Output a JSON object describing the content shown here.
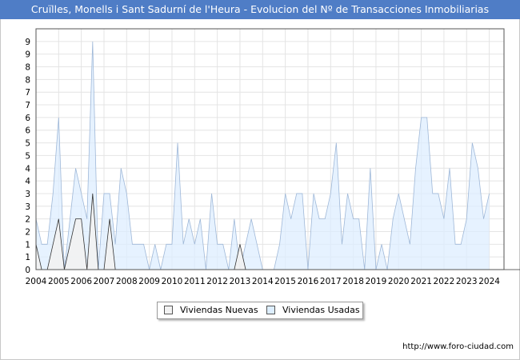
{
  "header": {
    "title": "Cruïlles, Monells i Sant Sadurní de l'Heura - Evolucion del Nº de Transacciones Inmobiliarias"
  },
  "footer": {
    "source": "http://www.foro-ciudad.com"
  },
  "chart_data": {
    "type": "area",
    "title": "Cruïlles, Monells i Sant Sadurní de l'Heura - Evolucion del Nº de Transacciones Inmobiliarias",
    "xlabel": "",
    "ylabel": "",
    "x_ticks": [
      "2004",
      "2005",
      "2006",
      "2007",
      "2008",
      "2009",
      "2010",
      "2011",
      "2012",
      "2013",
      "2014",
      "2015",
      "2016",
      "2017",
      "2018",
      "2019",
      "2020",
      "2021",
      "2022",
      "2023",
      "2024"
    ],
    "y_ticks": [
      "0",
      "1",
      "1",
      "2",
      "2",
      "3",
      "3",
      "4",
      "4",
      "5",
      "5",
      "6",
      "6",
      "7",
      "7",
      "8",
      "8",
      "9",
      "9"
    ],
    "ylim": [
      0,
      9.5
    ],
    "grid": true,
    "legend_position": "bottom",
    "x_unit": "quarter index (0 = 2004 Q1)",
    "series": [
      {
        "name": "Viviendas Nuevas",
        "color": "#f2f2f2",
        "stroke": "#333333",
        "values": [
          1,
          0,
          0,
          1,
          2,
          0,
          1,
          2,
          2,
          0,
          3,
          0,
          0,
          2,
          0,
          0,
          0,
          0,
          0,
          0,
          0,
          0,
          0,
          0,
          0,
          0,
          0,
          0,
          0,
          0,
          0,
          0,
          0,
          0,
          0,
          0,
          1,
          0,
          0,
          0,
          0,
          0,
          0,
          0,
          0,
          0,
          0,
          0,
          0,
          0,
          0,
          0,
          0,
          0,
          0,
          0,
          0,
          0,
          0,
          0,
          0,
          0,
          0,
          0,
          0,
          0,
          0,
          0,
          0,
          0,
          0,
          0,
          0,
          0,
          0,
          0,
          0,
          0,
          0,
          0,
          0,
          0,
          0,
          0,
          0,
          0,
          0,
          0,
          0,
          0,
          0,
          0,
          0
        ]
      },
      {
        "name": "Viviendas Usadas",
        "color": "#ddeeff",
        "stroke": "#9fb8d8",
        "values": [
          2,
          1,
          1,
          3,
          6,
          0,
          2,
          4,
          3,
          2,
          9,
          0,
          3,
          3,
          1,
          4,
          3,
          1,
          1,
          1,
          0,
          1,
          0,
          1,
          1,
          5,
          1,
          2,
          1,
          2,
          0,
          3,
          1,
          1,
          0,
          2,
          0,
          1,
          2,
          1,
          0,
          0,
          0,
          1,
          3,
          2,
          3,
          3,
          0,
          3,
          2,
          2,
          3,
          5,
          1,
          3,
          2,
          2,
          0,
          4,
          0,
          1,
          0,
          2,
          3,
          2,
          1,
          4,
          6,
          6,
          3,
          3,
          2,
          4,
          1,
          1,
          2,
          5,
          4,
          2,
          3
        ]
      }
    ]
  }
}
